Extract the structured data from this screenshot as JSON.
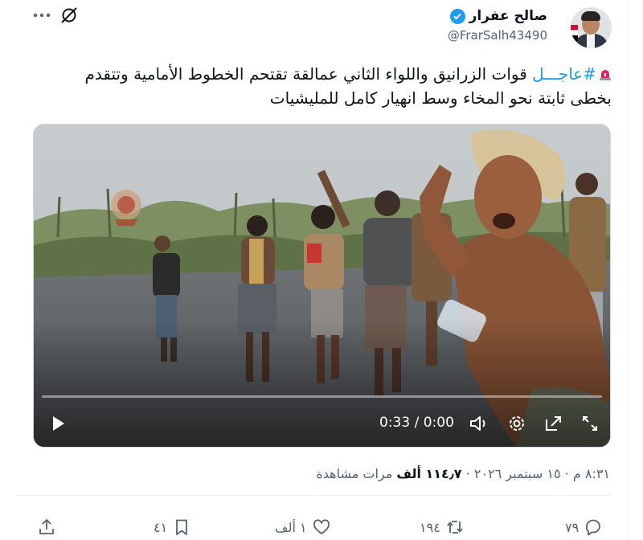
{
  "author": {
    "display_name": "صالح عفرار",
    "handle": "@FrarSalh43490",
    "verified": true
  },
  "icons": {
    "more": "more-horizontal-icon",
    "grok": "grok-icon",
    "verified": "verified-badge-icon",
    "siren": "rotating-light-emoji"
  },
  "tweet": {
    "hashtag": "#عاجـــل",
    "line1_rest": " قوات الزرانيق واللواء الثاني عمالقة تقتحم الخطوط الأمامية وتتقدم",
    "line2": "بخطى ثابتة نحو المخاء وسط انهيار كامل للمليشيات"
  },
  "video": {
    "time_display": "0:33 / 0:00",
    "progress": 0.0,
    "watermark": "logo"
  },
  "meta": {
    "time": "٨:٣١ م",
    "separator1": "·",
    "date": "١٥ سبتمبر ٢٠٢٦",
    "separator2": "·",
    "views_count": "١١٤٫٧ ألف",
    "views_label": "مرات مشاهدة"
  },
  "actions": {
    "replies": "٧٩",
    "reposts": "١٩٤",
    "likes": "١ ألف",
    "bookmarks": "٤١"
  },
  "colors": {
    "accent": "#1d9bf0",
    "text": "#0f1419",
    "secondary": "#536471",
    "siren_red": "#e0245e"
  }
}
